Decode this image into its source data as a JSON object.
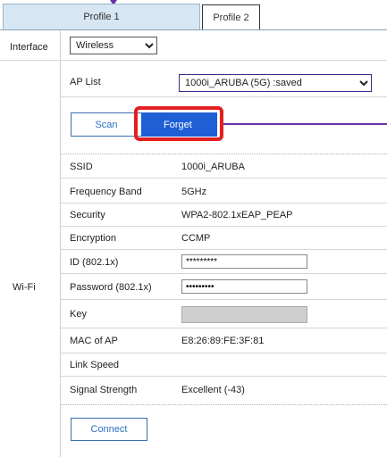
{
  "tabs": [
    {
      "label": "Profile 1",
      "active": true
    },
    {
      "label": "Profile 2",
      "active": false
    }
  ],
  "interface": {
    "label": "Interface",
    "selected": "Wireless",
    "options": [
      "Wireless"
    ]
  },
  "wifi_section_label": "Wi-Fi",
  "ap_list": {
    "label": "AP List",
    "selected": "1000i_ARUBA (5G) :saved"
  },
  "buttons": {
    "scan": "Scan",
    "forget": "Forget",
    "connect": "Connect"
  },
  "fields": [
    {
      "label": "SSID",
      "value": "1000i_ARUBA"
    },
    {
      "label": "Frequency Band",
      "value": "5GHz"
    },
    {
      "label": "Security",
      "value": "WPA2-802.1xEAP_PEAP"
    },
    {
      "label": "Encryption",
      "value": "CCMP"
    },
    {
      "label": "ID (802.1x)",
      "value": "*********"
    },
    {
      "label": "Password (802.1x)",
      "value": "•••••••••"
    },
    {
      "label": "Key",
      "value": ""
    },
    {
      "label": "MAC of AP",
      "value": "E8:26:89:FE:3F:81"
    },
    {
      "label": "Link Speed",
      "value": ""
    },
    {
      "label": "Signal Strength",
      "value": "Excellent (-43)"
    }
  ],
  "colors": {
    "active_tab_bg": "#d6e6f3",
    "forget_bg": "#1f5fd6",
    "highlight": "#e1201f",
    "callout": "#6b2fa8"
  }
}
